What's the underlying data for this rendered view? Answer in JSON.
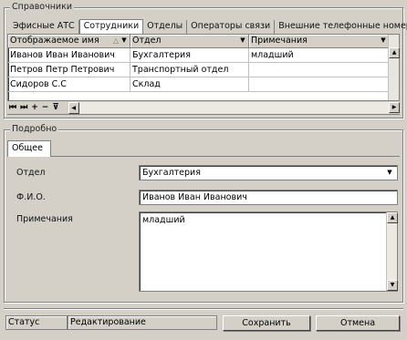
{
  "reference": {
    "title": "Справочники",
    "tabs": [
      "Эфисные АТС",
      "Сотрудники",
      "Отделы",
      "Операторы связи",
      "Внешние телефонные номера"
    ],
    "active_tab": "Сотрудники",
    "columns": [
      "Отображаемое имя",
      "Отдел",
      "Примечания"
    ],
    "rows": [
      [
        "Иванов Иван Иванович",
        "Бухгалтерия",
        "младший"
      ],
      [
        "Петров Петр Петрович",
        "Транспортный отдел",
        ""
      ],
      [
        "Сидоров С.С",
        "Склад",
        ""
      ]
    ],
    "navigator": [
      "⏮",
      "⏭",
      "+",
      "−",
      "⊽"
    ]
  },
  "detail": {
    "title": "Подробно",
    "tab": "Общее",
    "department_label": "Отдел",
    "department_value": "Бухгалтерия",
    "fio_label": "Ф.И.О.",
    "fio_value": "Иванов Иван Иванович",
    "notes_label": "Примечания",
    "notes_value": "младший"
  },
  "footer": {
    "status_label": "Статус",
    "status_value": "Редактирование",
    "save_label": "Сохранить",
    "cancel_label": "Отмена"
  },
  "icons": {
    "dropdown": "chevron-down-icon",
    "sort": "sort-asc-icon"
  }
}
